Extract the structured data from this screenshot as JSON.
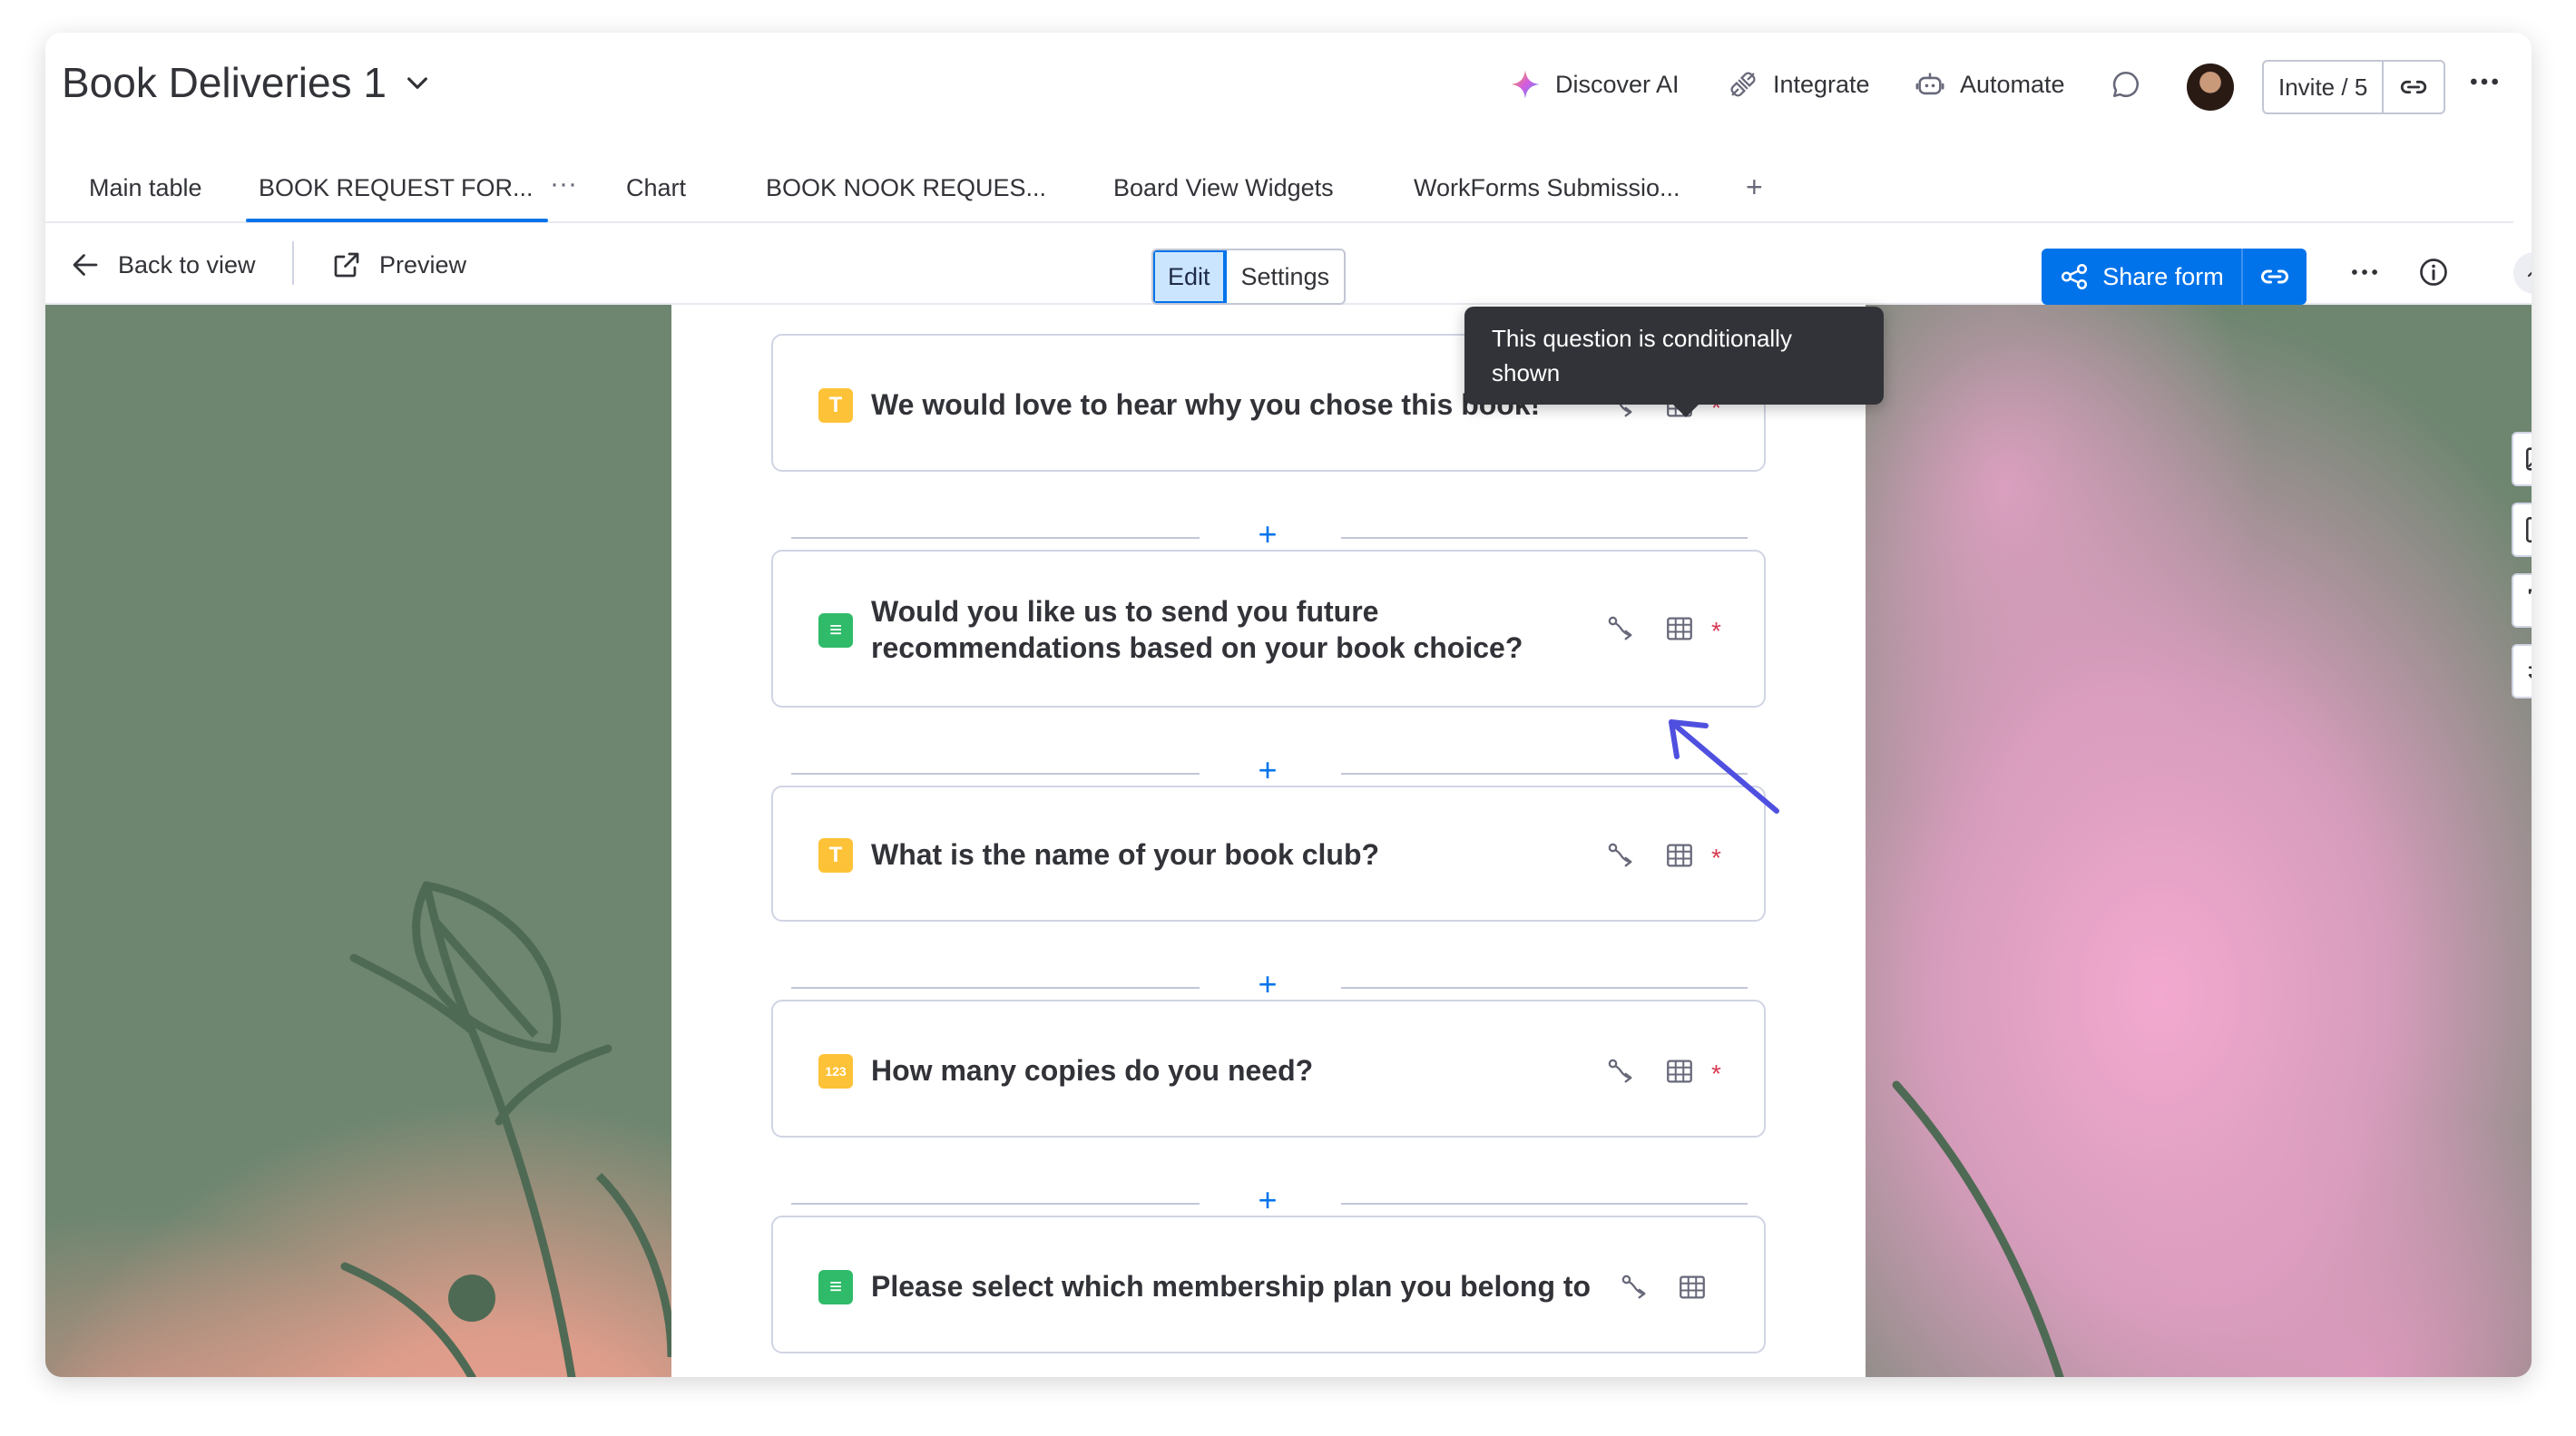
{
  "header": {
    "board_title": "Book Deliveries 1",
    "discover_ai": "Discover AI",
    "integrate": "Integrate",
    "automate": "Automate",
    "invite": "Invite / 5"
  },
  "tabs": [
    {
      "label": "Main table"
    },
    {
      "label": "BOOK REQUEST FOR...",
      "active": true
    },
    {
      "label": "Chart"
    },
    {
      "label": "BOOK NOOK REQUES..."
    },
    {
      "label": "Board View Widgets"
    },
    {
      "label": "WorkForms Submissio..."
    }
  ],
  "toolbar": {
    "back": "Back to view",
    "preview": "Preview",
    "edit": "Edit",
    "settings": "Settings",
    "share_form": "Share form"
  },
  "tooltip": {
    "text": "This question is conditionally shown"
  },
  "questions": [
    {
      "type": "text",
      "type_glyph": "T",
      "title": "We would love to hear why you chose this book!",
      "conditional": true,
      "required": true
    },
    {
      "type": "list",
      "type_glyph": "≡",
      "title": "Would you like us to send you future recommendations based on your book choice?",
      "conditional": true,
      "required": true
    },
    {
      "type": "text",
      "type_glyph": "T",
      "title": "What is the name of your book club?",
      "conditional": true,
      "required": true
    },
    {
      "type": "numbers",
      "type_glyph": "123",
      "title": "How many copies do you need?",
      "conditional": true,
      "required": true
    },
    {
      "type": "list",
      "type_glyph": "≡",
      "title": "Please select which membership plan you belong to",
      "conditional": true,
      "required": false
    }
  ],
  "required_marker": "*",
  "colors": {
    "primary": "#0073ea",
    "required": "#d83a52",
    "text_type_icon": "#fdc237",
    "list_type_icon": "#2fbb69",
    "annotation_arrow": "#4f4fe0"
  }
}
